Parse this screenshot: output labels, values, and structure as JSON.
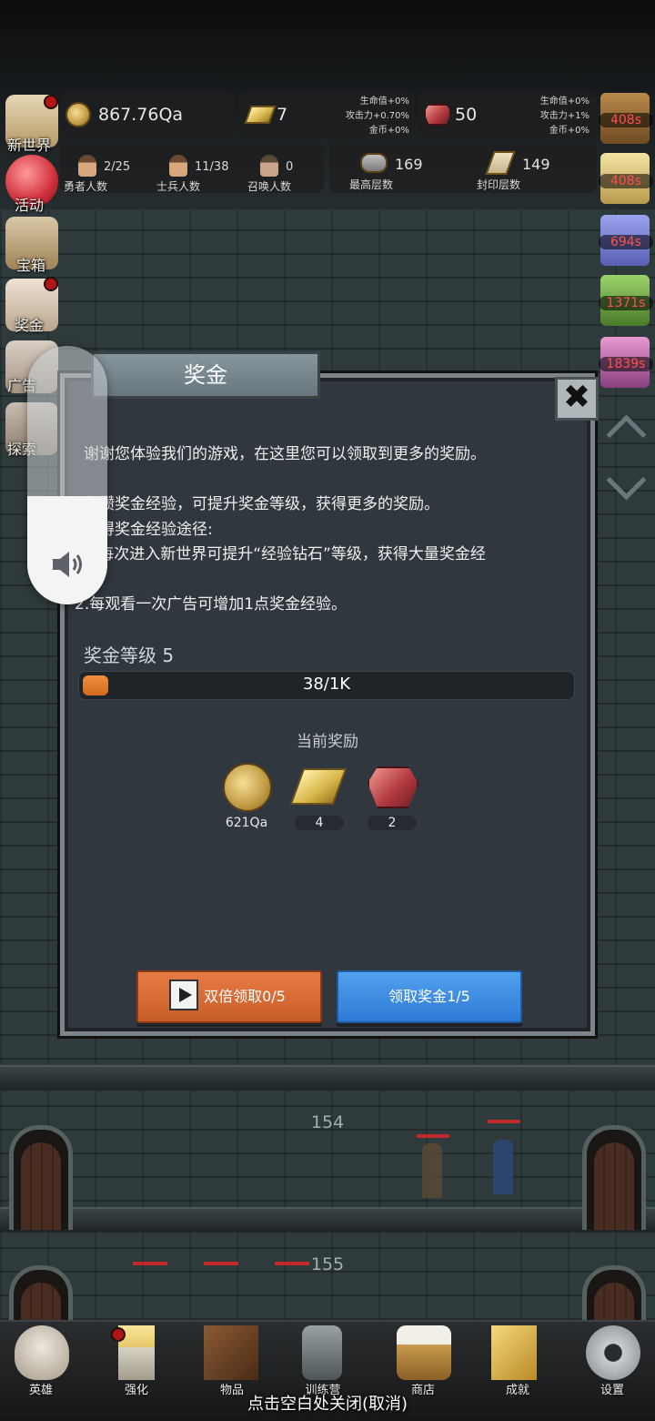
{
  "hud": {
    "gold": "867.76Qa",
    "gold_bar": "7",
    "gold_bar_bonus": [
      "生命值+0%",
      "攻击力+0.70%",
      "金币+0%"
    ],
    "gem": "50",
    "gem_bonus": [
      "生命值+0%",
      "攻击力+1%",
      "金币+0%"
    ],
    "heroes": {
      "value": "2/25",
      "label": "勇者人数"
    },
    "soldiers": {
      "value": "11/38",
      "label": "士兵人数"
    },
    "summons": {
      "value": "0",
      "label": "召唤人数"
    },
    "max_floor": {
      "value": "169",
      "label": "最高层数"
    },
    "sealed_floor": {
      "value": "149",
      "label": "封印层数"
    }
  },
  "left_menu": [
    "新世界",
    "活动",
    "宝箱",
    "奖金",
    "广告",
    "探索"
  ],
  "right_timers": [
    "408s",
    "408s",
    "694s",
    "1371s",
    "1839s"
  ],
  "floors": {
    "upper": "154",
    "lower": "155"
  },
  "dialog": {
    "title": "奖金",
    "close_label": "✖",
    "lines": [
      "谢谢您体验我们的游戏，在这里您可以领取到更多的奖励。",
      "积攒奖金经验，可提升奖金等级，获得更多的奖励。",
      "获得奖金经验途径:",
      "1.每次进入新世界可提升“经验钻石”等级，获得大量奖金经",
      "2.每观看一次广告可增加1点奖金经验。"
    ],
    "level_label": "奖金等级 5",
    "progress_text": "38/1K",
    "progress_fraction": 0.038,
    "rewards_title": "当前奖励",
    "rewards": [
      {
        "icon": "gold-coin-icon",
        "value": "621Qa"
      },
      {
        "icon": "gold-bar-icon",
        "value": "4"
      },
      {
        "icon": "ruby-icon",
        "value": "2"
      }
    ],
    "double_button": "双倍领取0/5",
    "claim_button": "领取奖金1/5"
  },
  "volume": {
    "level": 0.42,
    "icon": "speaker-icon"
  },
  "bottom_tabs": [
    "英雄",
    "强化",
    "物品",
    "训练营",
    "商店",
    "成就",
    "设置"
  ],
  "hint": "点击空白处关闭(取消)",
  "colors": {
    "orange_button": "#d46a33",
    "blue_button": "#3f8de2",
    "progress": "#e67f2e",
    "timer": "#ff4f4f"
  }
}
